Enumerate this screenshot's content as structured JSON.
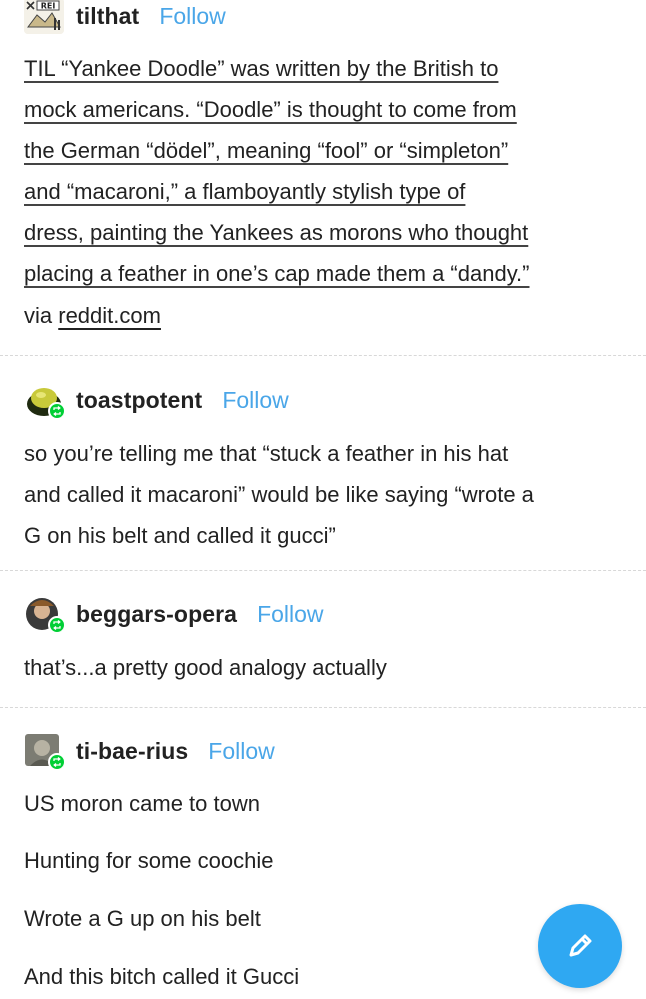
{
  "posts": [
    {
      "username": "tilthat",
      "follow_label": "Follow",
      "avatar_text": "REI",
      "body_lines": [
        "TIL “Yankee Doodle” was written by the British to",
        "mock americans. “Doodle” is thought to come from",
        "the German “dödel”, meaning “fool” or “simpleton”",
        "and “macaroni,” a flamboyantly stylish type of",
        "dress, painting the Yankees as morons who thought",
        "placing a feather in one’s cap made them a “dandy.”"
      ],
      "source_prefix": "via",
      "source_link": "reddit.com"
    },
    {
      "username": "toastpotent",
      "follow_label": "Follow",
      "body_lines": [
        "so you’re telling me that “stuck a feather in his hat",
        "and called it macaroni” would be like saying “wrote a",
        "G on his belt and called it gucci”"
      ]
    },
    {
      "username": "beggars-opera",
      "follow_label": "Follow",
      "body_lines": [
        "that’s...a pretty good analogy actually"
      ]
    },
    {
      "username": "ti-bae-rius",
      "follow_label": "Follow",
      "body_lines": [
        "US moron came to town",
        "Hunting for some coochie",
        "Wrote a G up on his belt",
        "And this bitch called it Gucci"
      ]
    }
  ],
  "icons": {
    "reblog": "reblog-icon",
    "compose": "pencil-icon"
  },
  "colors": {
    "follow": "#4aa6e8",
    "reblog_badge": "#00cf35",
    "compose_button": "#2fa8f2"
  }
}
